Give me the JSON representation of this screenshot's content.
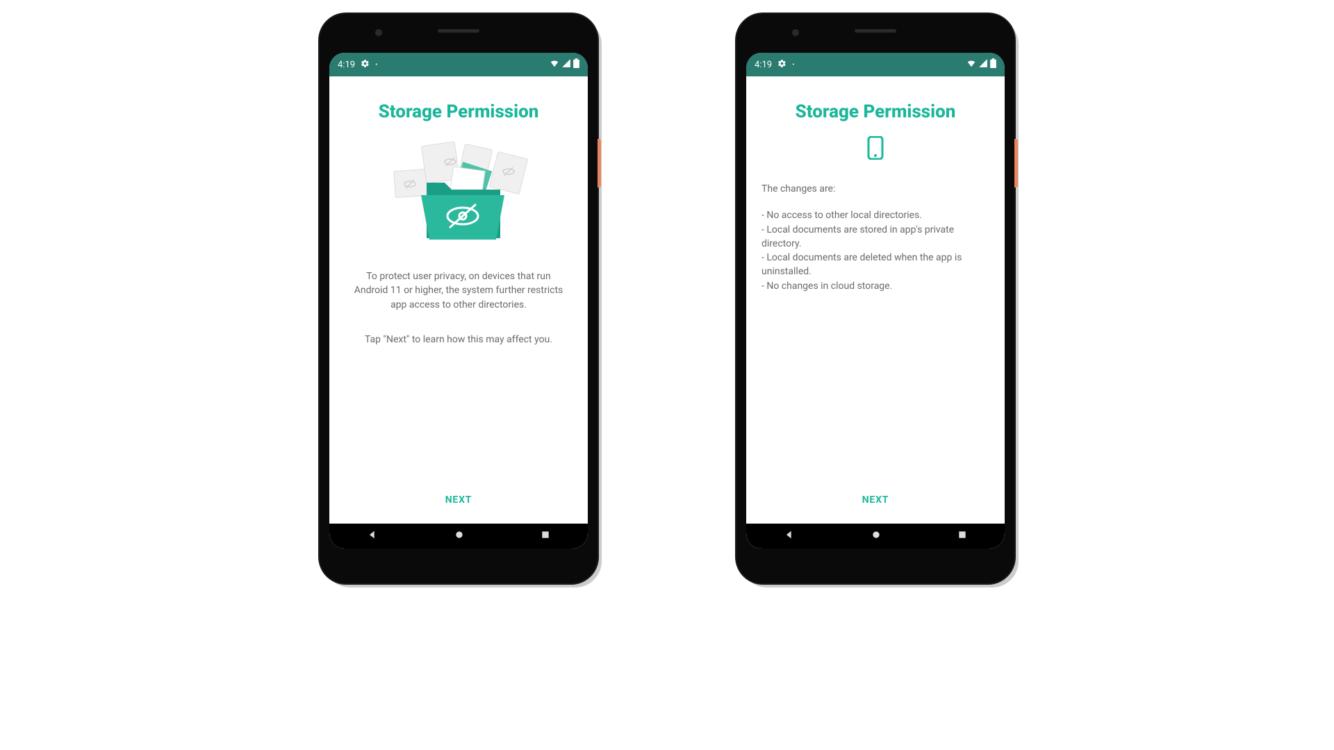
{
  "status": {
    "time": "4:19",
    "gear_icon": "gear",
    "dot_icon": "•",
    "wifi_icon": "wifi",
    "signal_icon": "signal",
    "battery_icon": "battery"
  },
  "colors": {
    "accent": "#1bb79a",
    "status_bar": "#2a7b70",
    "text_muted": "#6a6a6a"
  },
  "screen1": {
    "title": "Storage Permission",
    "hero_icon": "folder-eye-off",
    "paragraph1": "To protect user privacy, on devices that run Android 11 or higher, the system further restricts app access to other directories.",
    "paragraph2": "Tap \"Next\" to learn how this may affect you.",
    "next_label": "NEXT"
  },
  "screen2": {
    "title": "Storage Permission",
    "hero_icon": "smartphone",
    "intro": "The changes are:",
    "bullets": [
      "- No access to other local directories.",
      "- Local documents are stored in app's private directory.",
      "- Local documents are deleted when the app is uninstalled.",
      "- No changes in cloud storage."
    ],
    "next_label": "NEXT"
  },
  "nav": {
    "back_icon": "triangle-left",
    "home_icon": "circle",
    "recents_icon": "square"
  }
}
